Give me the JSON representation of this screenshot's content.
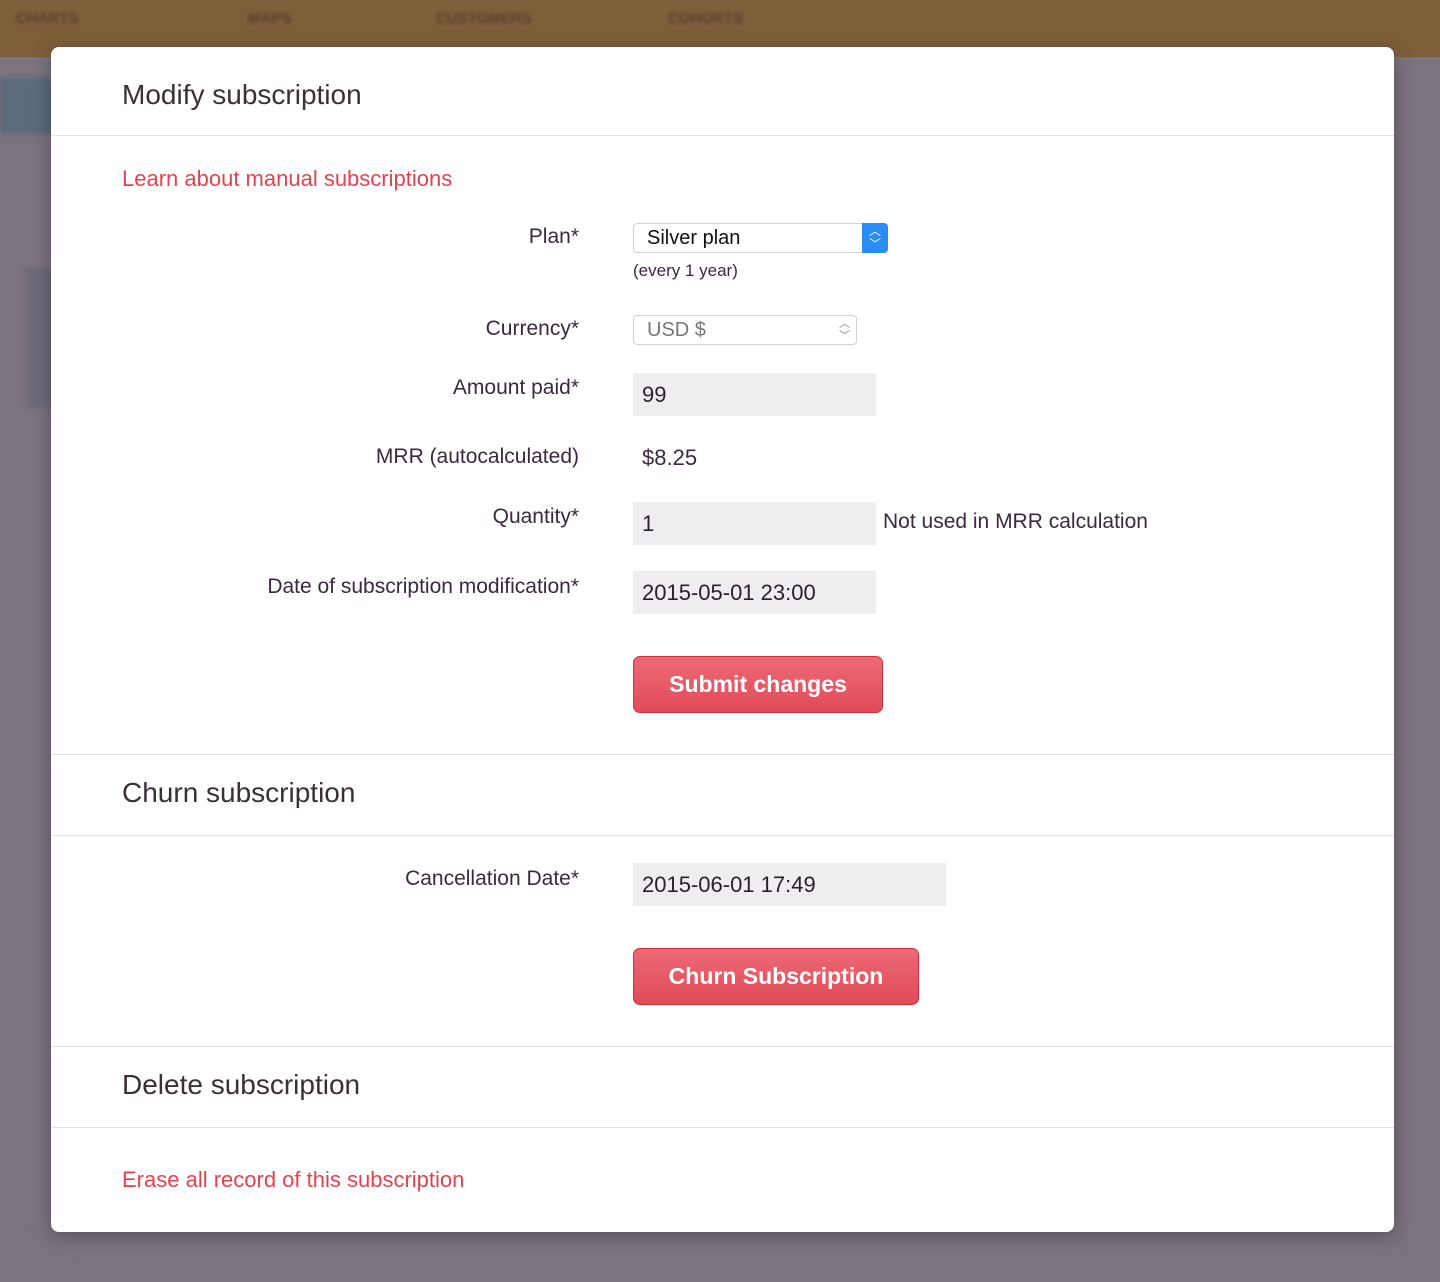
{
  "nav": [
    "CHARTS",
    "MAPS",
    "CUSTOMERS",
    "COHORTS"
  ],
  "modify": {
    "title": "Modify subscription",
    "learn_link": "Learn about manual subscriptions",
    "plan_label": "Plan*",
    "plan_value": "Silver plan",
    "plan_interval": "(every 1 year)",
    "currency_label": "Currency*",
    "currency_value": "USD $",
    "amount_label": "Amount paid*",
    "amount_value": "99",
    "mrr_label": "MRR (autocalculated)",
    "mrr_value": "$8.25",
    "quantity_label": "Quantity*",
    "quantity_value": "1",
    "quantity_note": "Not used in MRR calculation",
    "date_label": "Date of subscription modification*",
    "date_value": "2015-05-01 23:00",
    "submit": "Submit changes"
  },
  "churn": {
    "title": "Churn subscription",
    "date_label": "Cancellation Date*",
    "date_value": "2015-06-01 17:49",
    "button": "Churn Subscription"
  },
  "delete": {
    "title": "Delete subscription",
    "erase_link": "Erase all record of this subscription"
  },
  "colors": {
    "accent": "#e5424f",
    "topbar": "#7f5e3a",
    "select_blue": "#2a8cf5"
  }
}
